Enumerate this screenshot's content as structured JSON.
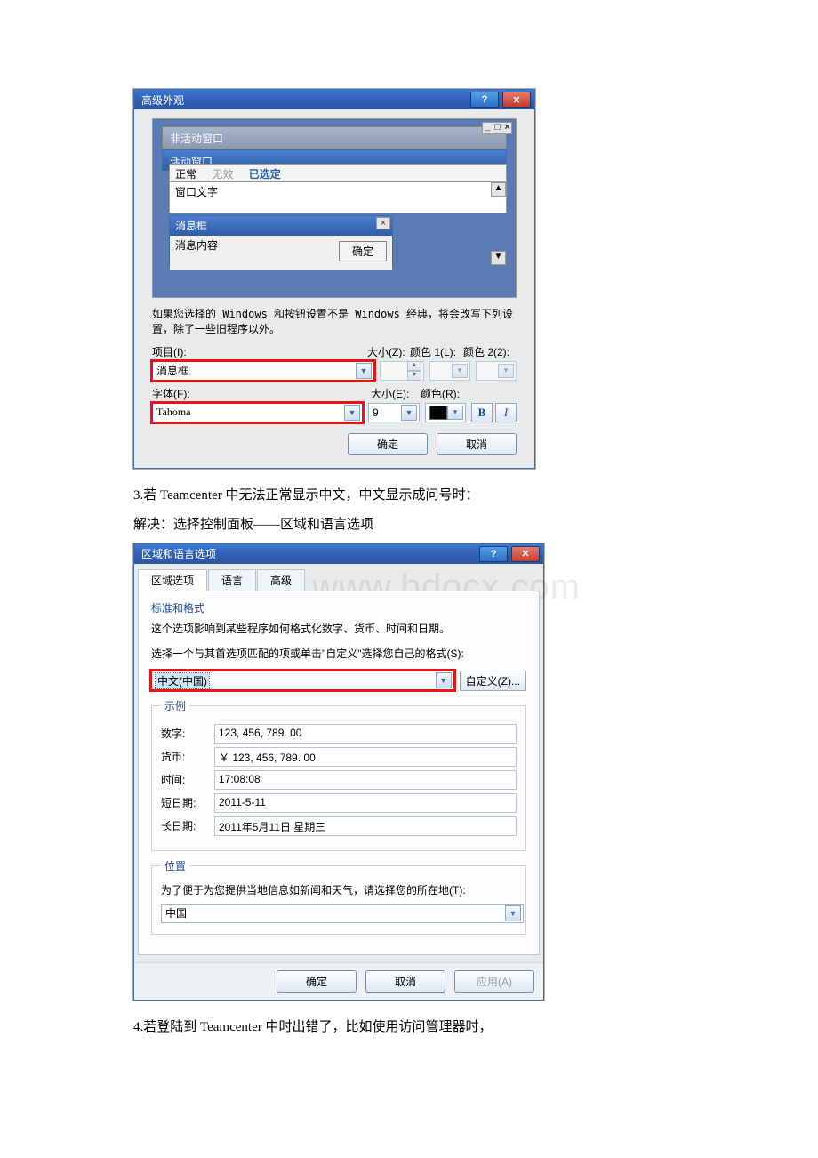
{
  "advanced": {
    "title": "高级外观",
    "preview": {
      "inactiveTitle": "非活动窗口",
      "activeTitle": "活动窗口",
      "menu": {
        "normal": "正常",
        "disabled": "无效",
        "selected": "已选定"
      },
      "textLabel": "窗口文字",
      "msgboxTitle": "消息框",
      "msgboxContent": "消息内容",
      "okBtn": "确定",
      "winCtrl": "_ □ ×"
    },
    "note": "如果您选择的 Windows 和按钮设置不是 Windows 经典，将会改写下列设置，除了一些旧程序以外。",
    "labels": {
      "item": "项目(I):",
      "sizeZ": "大小(Z):",
      "color1": "颜色 1(L):",
      "color2": "颜色 2(2):",
      "font": "字体(F):",
      "sizeE": "大小(E):",
      "colorR": "颜色(R):"
    },
    "values": {
      "item": "消息框",
      "font": "Tahoma",
      "fontSize": "9"
    },
    "footer": {
      "ok": "确定",
      "cancel": "取消"
    }
  },
  "doc": {
    "line3": "3.若 Teamcenter 中无法正常显示中文，中文显示成问号时：",
    "line3b": "解决：选择控制面板——区域和语言选项",
    "line4": "4.若登陆到 Teamcenter 中时出错了，比如使用访问管理器时，"
  },
  "watermark": "www.bdocx.com",
  "region": {
    "title": "区域和语言选项",
    "tabs": {
      "options": "区域选项",
      "language": "语言",
      "advanced": "高级"
    },
    "std": {
      "legend": "标准和格式",
      "desc1": "这个选项影响到某些程序如何格式化数字、货币、时间和日期。",
      "desc2": "选择一个与其首选项匹配的项或单击\"自定义\"选择您自己的格式(S):",
      "locale": "中文(中国)",
      "customize": "自定义(Z)..."
    },
    "sample": {
      "legend": "示例",
      "numberL": "数字:",
      "numberV": "123, 456, 789. 00",
      "currencyL": "货币:",
      "currencyV": "￥ 123, 456, 789. 00",
      "timeL": "时间:",
      "timeV": "17:08:08",
      "shortDateL": "短日期:",
      "shortDateV": "2011-5-11",
      "longDateL": "长日期:",
      "longDateV": "2011年5月11日 星期三"
    },
    "location": {
      "legend": "位置",
      "desc": "为了便于为您提供当地信息如新闻和天气，请选择您的所在地(T):",
      "value": "中国"
    },
    "footer": {
      "ok": "确定",
      "cancel": "取消",
      "apply": "应用(A)"
    }
  }
}
